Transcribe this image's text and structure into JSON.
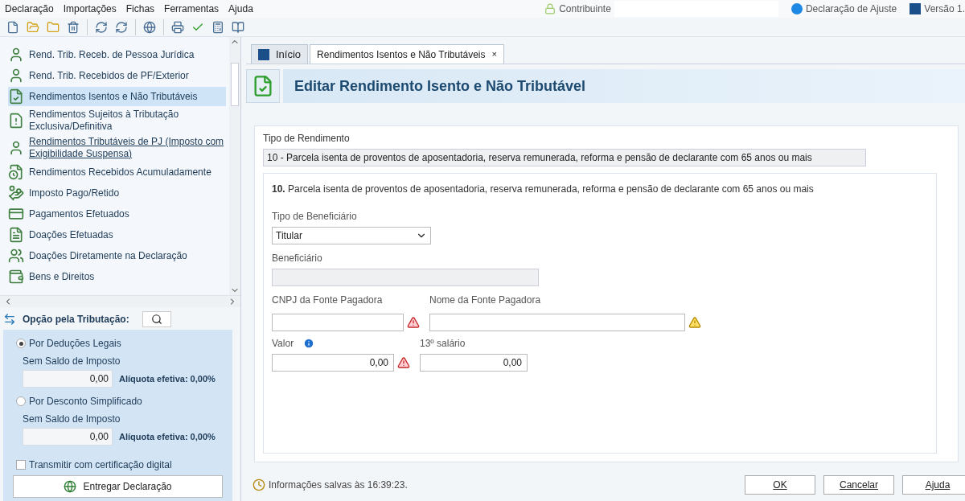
{
  "menu": [
    "Declaração",
    "Importações",
    "Fichas",
    "Ferramentas",
    "Ajuda"
  ],
  "header": {
    "contribuinte_label": "Contribuinte",
    "declaration": "Declaração de Ajuste",
    "version": "Versão 1."
  },
  "sidebar": {
    "items": [
      {
        "label": "Rend. Trib. Receb. de Pessoa Jurídica",
        "selected": false,
        "hovered": false
      },
      {
        "label": "Rend. Trib. Recebidos de PF/Exterior",
        "selected": false,
        "hovered": false
      },
      {
        "label": "Rendimentos Isentos e Não Tributáveis",
        "selected": true,
        "hovered": false
      },
      {
        "label": "Rendimentos Sujeitos à Tributação Exclusiva/Definitiva",
        "selected": false,
        "hovered": false
      },
      {
        "label": "Rendimentos Tributáveis de PJ (Imposto com Exigibilidade Suspensa)",
        "selected": false,
        "hovered": true
      },
      {
        "label": "Rendimentos Recebidos Acumuladamente",
        "selected": false,
        "hovered": false
      },
      {
        "label": "Imposto Pago/Retido",
        "selected": false,
        "hovered": false
      },
      {
        "label": "Pagamentos Efetuados",
        "selected": false,
        "hovered": false
      },
      {
        "label": "Doações Efetuadas",
        "selected": false,
        "hovered": false
      },
      {
        "label": "Doações Diretamente na Declaração",
        "selected": false,
        "hovered": false
      },
      {
        "label": "Bens e Direitos",
        "selected": false,
        "hovered": false
      }
    ]
  },
  "tributacao": {
    "title": "Opção pela Tributação:",
    "options": [
      {
        "label": "Por Deduções Legais",
        "selected": true,
        "sublabel": "Sem Saldo de Imposto",
        "value": "0,00",
        "aliquota": "Alíquota efetiva: 0,00%"
      },
      {
        "label": "Por Desconto Simplificado",
        "selected": false,
        "sublabel": "Sem Saldo de Imposto",
        "value": "0,00",
        "aliquota": "Alíquota efetiva: 0,00%"
      }
    ],
    "certificacao": {
      "label": "Transmitir com certificação digital",
      "checked": false
    },
    "submit": "Entregar Declaração"
  },
  "tabs": [
    {
      "label": "Início",
      "selected": false
    },
    {
      "label": "Rendimentos Isentos e Não Tributáveis",
      "selected": true,
      "close": "×"
    }
  ],
  "page_title": "Editar Rendimento Isento e Não Tributável",
  "form": {
    "tipo_label": "Tipo de Rendimento",
    "tipo_value": "10 - Parcela isenta de proventos de aposentadoria, reserva remunerada, reforma e pensão de declarante com 65 anos ou mais",
    "description": "**10.** Parcela isenta de proventos de aposentadoria, reserva remunerada, reforma e pensão de declarante com 65 anos ou mais",
    "beneficiario_tipo_label": "Tipo de Beneficiário",
    "beneficiario_tipo_value": "Titular",
    "beneficiario_label": "Beneficiário",
    "cnpj": {
      "label": "CNPJ da Fonte Pagadora",
      "error": true,
      "warning": false
    },
    "nome": {
      "label": "Nome da Fonte Pagadora",
      "error": false,
      "warning": true
    },
    "valor": {
      "label": "Valor",
      "value": "0,00",
      "error": true,
      "warning": false
    },
    "decimo": {
      "label": "13º salário",
      "value": "0,00",
      "error": false,
      "warning": false
    }
  },
  "status": "Informações salvas às 16:39:23.",
  "buttons": [
    "OK",
    "Cancelar",
    "Ajuda"
  ]
}
